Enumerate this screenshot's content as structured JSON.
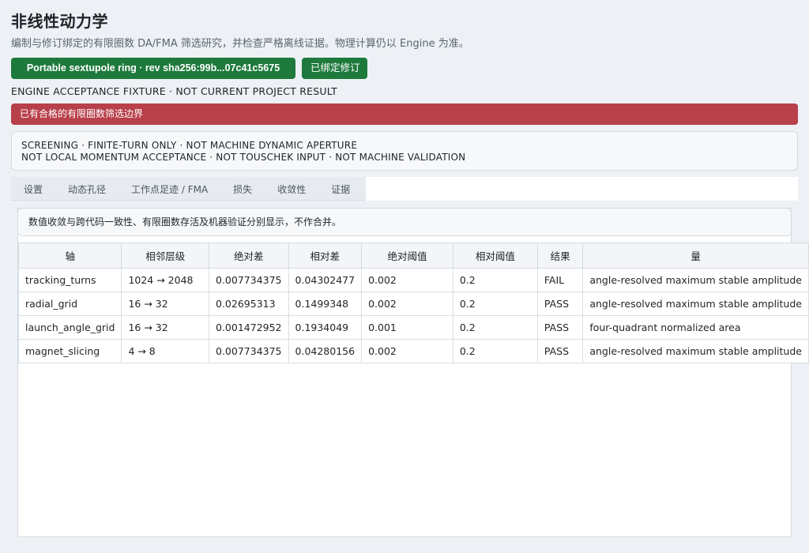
{
  "header": {
    "title": "非线性动力学",
    "subtitle": "编制与修订绑定的有限圈数 DA/FMA 筛选研究，并检查严格离线证据。物理计算仍以 Engine 为准。"
  },
  "toolbar": {
    "revision_label": "Portable sextupole ring · rev sha256:99b...07c41c5675",
    "bound_label": "已绑定修订"
  },
  "fixture_text": "ENGINE ACCEPTANCE FIXTURE · NOT CURRENT PROJECT RESULT",
  "alert_text": "已有合格的有限圈数筛选边界",
  "scope": {
    "line1": "SCREENING · FINITE-TURN ONLY · NOT MACHINE DYNAMIC APERTURE",
    "line2": "NOT LOCAL MOMENTUM ACCEPTANCE · NOT TOUSCHEK INPUT · NOT MACHINE VALIDATION"
  },
  "tabs": [
    "设置",
    "动态孔径",
    "工作点足迹 / FMA",
    "损失",
    "收敛性",
    "证据"
  ],
  "note_text": "数值收敛与跨代码一致性、有限圈数存活及机器验证分别显示，不作合并。",
  "table": {
    "headers": [
      "轴",
      "相邻层级",
      "绝对差",
      "相对差",
      "绝对阈值",
      "相对阈值",
      "结果",
      "量"
    ],
    "rows": [
      [
        "tracking_turns",
        "1024 → 2048",
        "0.007734375",
        "0.04302477",
        "0.002",
        "0.2",
        "FAIL",
        "angle-resolved maximum stable amplitude"
      ],
      [
        "radial_grid",
        "16 → 32",
        "0.02695313",
        "0.1499348",
        "0.002",
        "0.2",
        "PASS",
        "angle-resolved maximum stable amplitude"
      ],
      [
        "launch_angle_grid",
        "16 → 32",
        "0.001472952",
        "0.1934049",
        "0.001",
        "0.2",
        "PASS",
        "four-quadrant normalized area"
      ],
      [
        "magnet_slicing",
        "4 → 8",
        "0.007734375",
        "0.04280156",
        "0.002",
        "0.2",
        "PASS",
        "angle-resolved maximum stable amplitude"
      ]
    ]
  },
  "colors": {
    "primary_green": "#1e7a3c",
    "alert_red": "#b8404a",
    "background": "#edf1f5"
  }
}
